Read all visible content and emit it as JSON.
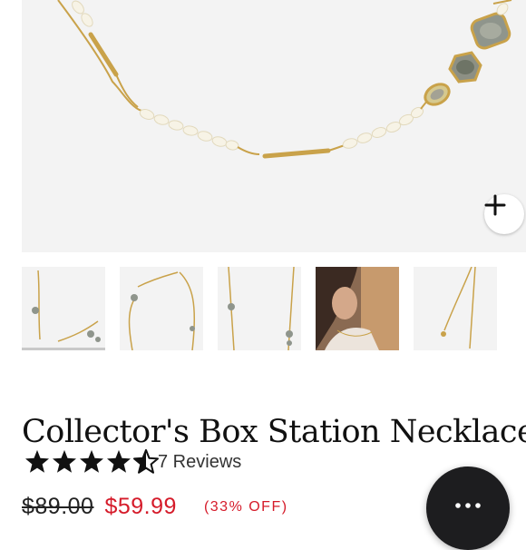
{
  "product": {
    "title": "Collector's Box Station Necklace",
    "rating": 4.5,
    "rating_max": 5,
    "reviews_label": "7 Reviews",
    "original_price": "$89.00",
    "sale_price": "$59.99",
    "discount_label": "(33% OFF)"
  },
  "gallery": {
    "thumbnails": [
      {
        "name": "thumbnail-1",
        "active": true
      },
      {
        "name": "thumbnail-2",
        "active": false
      },
      {
        "name": "thumbnail-3",
        "active": false
      },
      {
        "name": "thumbnail-4",
        "active": false
      },
      {
        "name": "thumbnail-5",
        "active": false
      }
    ]
  },
  "icons": {
    "zoom": "plus-icon",
    "chat": "more-dots-icon",
    "star": "star-icon"
  },
  "colors": {
    "sale_red": "#d51b2a",
    "text": "#111111",
    "gold": "#c9a24a"
  }
}
